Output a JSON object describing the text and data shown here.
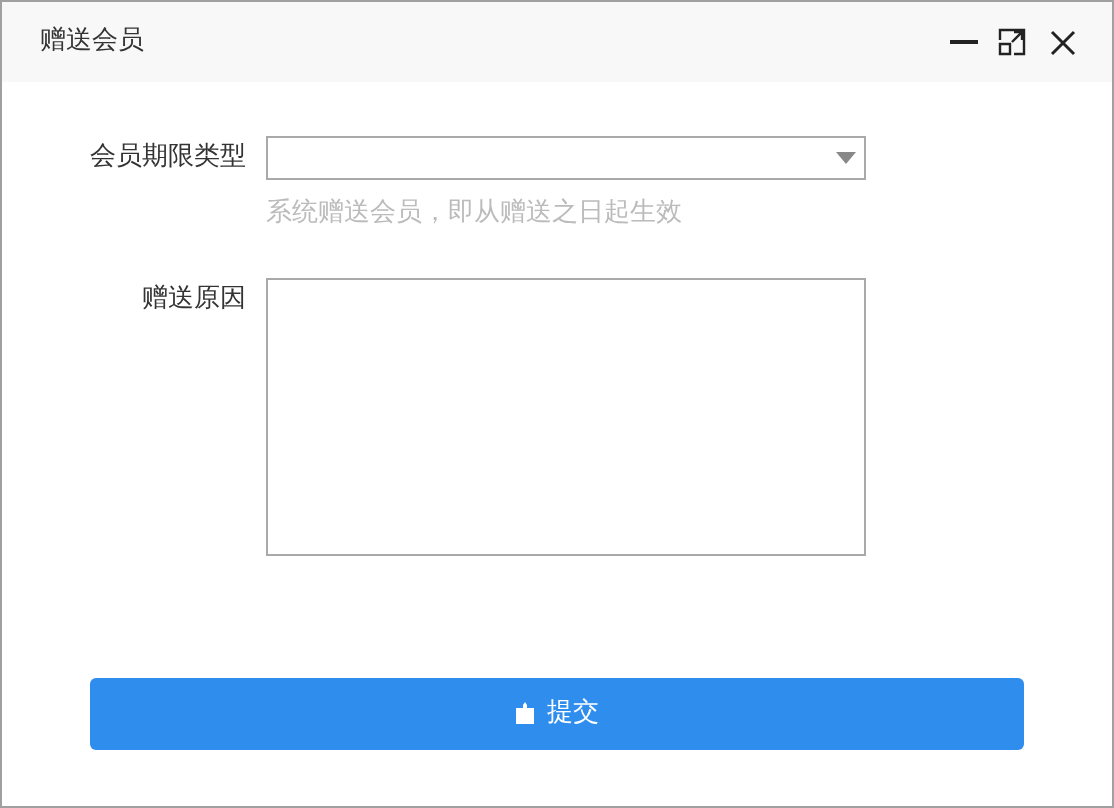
{
  "window": {
    "title": "赠送会员"
  },
  "fields": [
    {
      "kind": "select",
      "label": "会员期限类型",
      "hint": "系统赠送会员，即从赠送之日起生效"
    },
    {
      "kind": "textarea",
      "label": "赠送原因"
    }
  ],
  "submit": {
    "label": "提交"
  }
}
